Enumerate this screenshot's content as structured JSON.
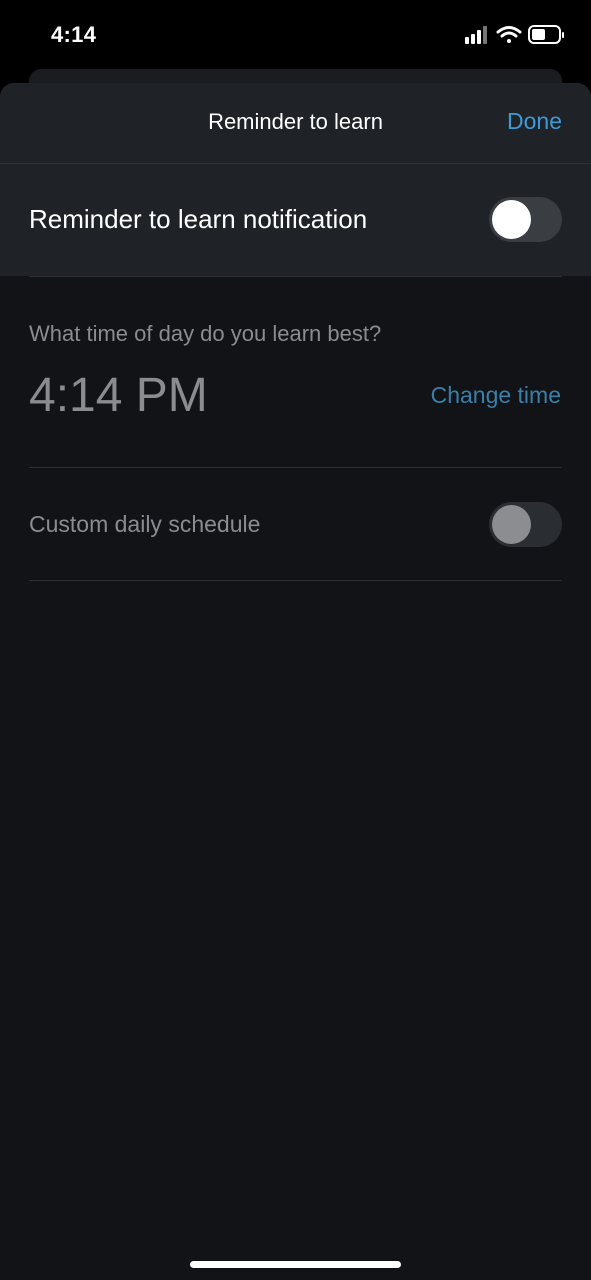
{
  "status_bar": {
    "time": "4:14",
    "icons": [
      "cellular-signal-icon",
      "wifi-icon",
      "battery-icon"
    ]
  },
  "nav": {
    "title": "Reminder to learn",
    "done_label": "Done"
  },
  "notification": {
    "label": "Reminder to learn notification",
    "enabled": false
  },
  "learn_time": {
    "question": "What time of day do you learn best?",
    "time": "4:14 PM",
    "change_label": "Change time"
  },
  "custom_schedule": {
    "label": "Custom daily schedule",
    "enabled": false
  },
  "colors": {
    "accent": "#3e9ad6",
    "background": "#111317",
    "panel": "#1f2226"
  }
}
